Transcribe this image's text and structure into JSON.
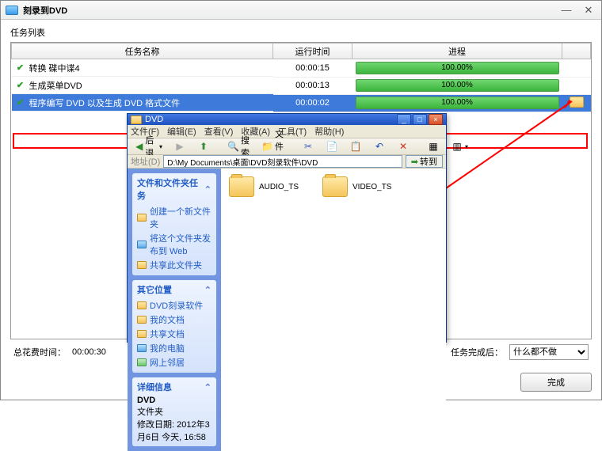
{
  "window": {
    "title": "刻录到DVD"
  },
  "section": "任务列表",
  "columns": {
    "name": "任务名称",
    "time": "运行时间",
    "progress": "进程"
  },
  "tasks": [
    {
      "name": "转换 碟中谍4",
      "time": "00:00:15",
      "pct": "100.00%"
    },
    {
      "name": "生成菜单DVD",
      "time": "00:00:13",
      "pct": "100.00%"
    },
    {
      "name": "程序编写 DVD 以及生成 DVD 格式文件",
      "time": "00:00:02",
      "pct": "100.00%"
    }
  ],
  "footer": {
    "total_label": "总花费时间：",
    "total_time": "00:00:30",
    "after_label": "任务完成后：",
    "after_value": "什么都不做",
    "finish": "完成"
  },
  "explorer": {
    "title": "DVD",
    "menu": [
      "文件(F)",
      "编辑(E)",
      "查看(V)",
      "收藏(A)",
      "工具(T)",
      "帮助(H)"
    ],
    "back": "后退",
    "search": "搜索",
    "folders": "文件夹",
    "addr_label": "地址(D)",
    "address": "D:\\My Documents\\桌面\\DVD刻录软件\\DVD",
    "go": "转到",
    "panel1": {
      "title": "文件和文件夹任务",
      "items": [
        "创建一个新文件夹",
        "将这个文件夹发布到 Web",
        "共享此文件夹"
      ]
    },
    "panel2": {
      "title": "其它位置",
      "items": [
        "DVD刻录软件",
        "我的文档",
        "共享文档",
        "我的电脑",
        "网上邻居"
      ]
    },
    "panel3": {
      "title": "详细信息",
      "name": "DVD",
      "type": "文件夹",
      "mod": "修改日期: 2012年3月6日 今天, 16:58"
    },
    "folders_c": [
      "AUDIO_TS",
      "VIDEO_TS"
    ]
  }
}
